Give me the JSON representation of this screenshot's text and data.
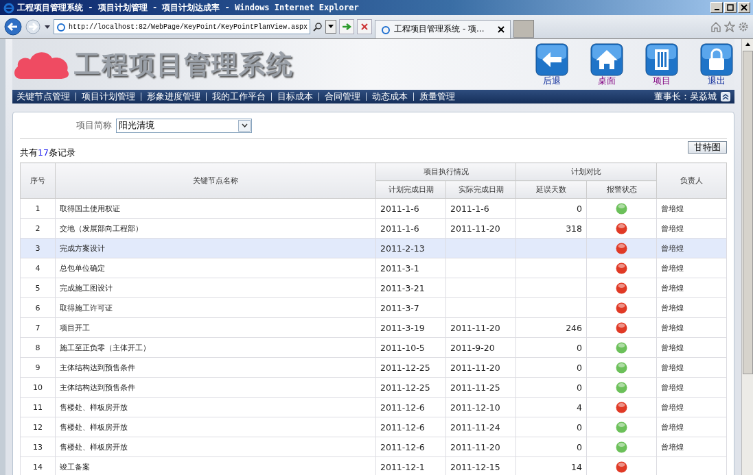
{
  "window": {
    "title": "工程项目管理系统 - 项目计划管理 - 项目计划达成率 - Windows Internet Explorer"
  },
  "browser": {
    "address": "http://localhost:82/WebPage/KeyPoint/KeyPointPlanView.aspx",
    "tab": "工程项目管理系统 - 项..."
  },
  "header": {
    "logo_text": "工程项目管理系统",
    "shortcuts": [
      {
        "label": "后退",
        "kind": "back",
        "visited": false
      },
      {
        "label": "桌面",
        "kind": "home",
        "visited": true
      },
      {
        "label": "项目",
        "kind": "project",
        "visited": true
      },
      {
        "label": "退出",
        "kind": "exit",
        "visited": false
      }
    ]
  },
  "nav": {
    "items": [
      "关键节点管理",
      "项目计划管理",
      "形象进度管理",
      "我的工作平台",
      "目标成本",
      "合同管理",
      "动态成本",
      "质量管理"
    ],
    "user": "董事长：吴荔城"
  },
  "filter": {
    "label": "项目简称",
    "value": "阳光清境"
  },
  "summary": {
    "prefix": "共有",
    "count": "17",
    "suffix": "条记录"
  },
  "gantt_button": "甘特图",
  "table": {
    "headers": {
      "index": "序号",
      "name": "关键节点名称",
      "group_exec": "项目执行情况",
      "planned": "计划完成日期",
      "actual": "实际完成日期",
      "group_compare": "计划对比",
      "delay": "延误天数",
      "status": "报警状态",
      "owner": "负责人"
    },
    "rows": [
      {
        "index": "1",
        "name": "取得国土使用权证",
        "planned": "2011-1-6",
        "actual": "2011-1-6",
        "delay": "0",
        "alarm": false,
        "owner": "曾培煌",
        "selected": false
      },
      {
        "index": "2",
        "name": "交地（发展部向工程部）",
        "planned": "2011-1-6",
        "actual": "2011-11-20",
        "delay": "318",
        "alarm": true,
        "owner": "曾培煌",
        "selected": false
      },
      {
        "index": "3",
        "name": "完成方案设计",
        "planned": "2011-2-13",
        "actual": "",
        "delay": "",
        "alarm": true,
        "owner": "曾培煌",
        "selected": true
      },
      {
        "index": "4",
        "name": "总包单位确定",
        "planned": "2011-3-1",
        "actual": "",
        "delay": "",
        "alarm": true,
        "owner": "曾培煌",
        "selected": false
      },
      {
        "index": "5",
        "name": "完成施工图设计",
        "planned": "2011-3-21",
        "actual": "",
        "delay": "",
        "alarm": true,
        "owner": "曾培煌",
        "selected": false
      },
      {
        "index": "6",
        "name": "取得施工许可证",
        "planned": "2011-3-7",
        "actual": "",
        "delay": "",
        "alarm": true,
        "owner": "曾培煌",
        "selected": false
      },
      {
        "index": "7",
        "name": "项目开工",
        "planned": "2011-3-19",
        "actual": "2011-11-20",
        "delay": "246",
        "alarm": true,
        "owner": "曾培煌",
        "selected": false
      },
      {
        "index": "8",
        "name": "施工至正负零（主体开工）",
        "planned": "2011-10-5",
        "actual": "2011-9-20",
        "delay": "0",
        "alarm": false,
        "owner": "曾培煌",
        "selected": false
      },
      {
        "index": "9",
        "name": "主体结构达到预售条件",
        "planned": "2011-12-25",
        "actual": "2011-11-20",
        "delay": "0",
        "alarm": false,
        "owner": "曾培煌",
        "selected": false
      },
      {
        "index": "10",
        "name": "主体结构达到预售条件",
        "planned": "2011-12-25",
        "actual": "2011-11-25",
        "delay": "0",
        "alarm": false,
        "owner": "曾培煌",
        "selected": false
      },
      {
        "index": "11",
        "name": "售楼处、样板房开放",
        "planned": "2011-12-6",
        "actual": "2011-12-10",
        "delay": "4",
        "alarm": true,
        "owner": "曾培煌",
        "selected": false
      },
      {
        "index": "12",
        "name": "售楼处、样板房开放",
        "planned": "2011-12-6",
        "actual": "2011-11-24",
        "delay": "0",
        "alarm": false,
        "owner": "曾培煌",
        "selected": false
      },
      {
        "index": "13",
        "name": "售楼处、样板房开放",
        "planned": "2011-12-6",
        "actual": "2011-11-20",
        "delay": "0",
        "alarm": false,
        "owner": "曾培煌",
        "selected": false
      },
      {
        "index": "14",
        "name": "竣工备案",
        "planned": "2011-12-1",
        "actual": "2011-12-15",
        "delay": "14",
        "alarm": true,
        "owner": "",
        "selected": false
      }
    ]
  }
}
